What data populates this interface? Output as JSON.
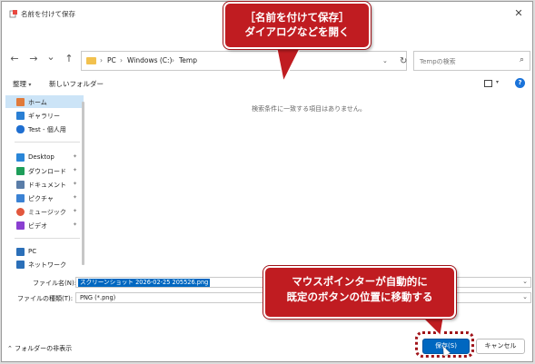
{
  "window": {
    "title": "名前を付けて保存",
    "close_glyph": "✕"
  },
  "navigation": {
    "back_glyph": "←",
    "forward_glyph": "→",
    "recent_glyph": "⌄",
    "up_glyph": "↑"
  },
  "address_bar": {
    "crumbs": [
      "PC",
      "Windows (C:)",
      "Temp"
    ],
    "separator": "›",
    "dropdown_glyph": "⌄",
    "refresh_glyph": "↻"
  },
  "search": {
    "placeholder": "Tempの検索",
    "icon_glyph": "⌕"
  },
  "toolbar": {
    "organize_label": "整理",
    "new_folder_label": "新しいフォルダー",
    "caret": "▾",
    "help_glyph": "?"
  },
  "sidebar": {
    "items": [
      {
        "label": "ホーム",
        "icon": "home-icon",
        "color": "#e07a3b",
        "selected": true,
        "pinned": false
      },
      {
        "label": "ギャラリー",
        "icon": "gallery-icon",
        "color": "#2a7fd4",
        "selected": false,
        "pinned": false
      },
      {
        "label": "Test - 個人用",
        "icon": "onedrive-icon",
        "color": "#1f6fd1",
        "selected": false,
        "pinned": false
      },
      {
        "label": "Desktop",
        "icon": "desktop-icon",
        "color": "#2a86d8",
        "selected": false,
        "pinned": true
      },
      {
        "label": "ダウンロード",
        "icon": "download-icon",
        "color": "#1e9e5a",
        "selected": false,
        "pinned": true
      },
      {
        "label": "ドキュメント",
        "icon": "documents-icon",
        "color": "#5a7da8",
        "selected": false,
        "pinned": true
      },
      {
        "label": "ピクチャ",
        "icon": "pictures-icon",
        "color": "#3b82d4",
        "selected": false,
        "pinned": true
      },
      {
        "label": "ミュージック",
        "icon": "music-icon",
        "color": "#e2573d",
        "selected": false,
        "pinned": true
      },
      {
        "label": "ビデオ",
        "icon": "videos-icon",
        "color": "#8a3fd1",
        "selected": false,
        "pinned": true
      },
      {
        "label": "PC",
        "icon": "pc-icon",
        "color": "#2b6fb8",
        "selected": false,
        "pinned": false
      },
      {
        "label": "ネットワーク",
        "icon": "network-icon",
        "color": "#2b6fb8",
        "selected": false,
        "pinned": false
      }
    ],
    "pin_glyph": "✦"
  },
  "content": {
    "empty_message": "検索条件に一致する項目はありません。"
  },
  "fields": {
    "filename_label": "ファイル名(N):",
    "filename_value": "スクリーンショット 2026-02-25 205526.png",
    "filetype_label": "ファイルの種類(T):",
    "filetype_value": "PNG (*.png)",
    "dropdown_glyph": "⌄"
  },
  "footer": {
    "hide_folders_label": "フォルダーの非表示",
    "hide_folders_glyph": "⌃",
    "save_label": "保存(S)",
    "cancel_label": "キャンセル"
  },
  "annotations": {
    "top_line1": "［名前を付けて保存］",
    "top_line2": "ダイアログなどを開く",
    "bottom_line1": "マウスポインターが自動的に",
    "bottom_line2": "既定のボタンの位置に移動する",
    "accent_color": "#c01c21"
  }
}
